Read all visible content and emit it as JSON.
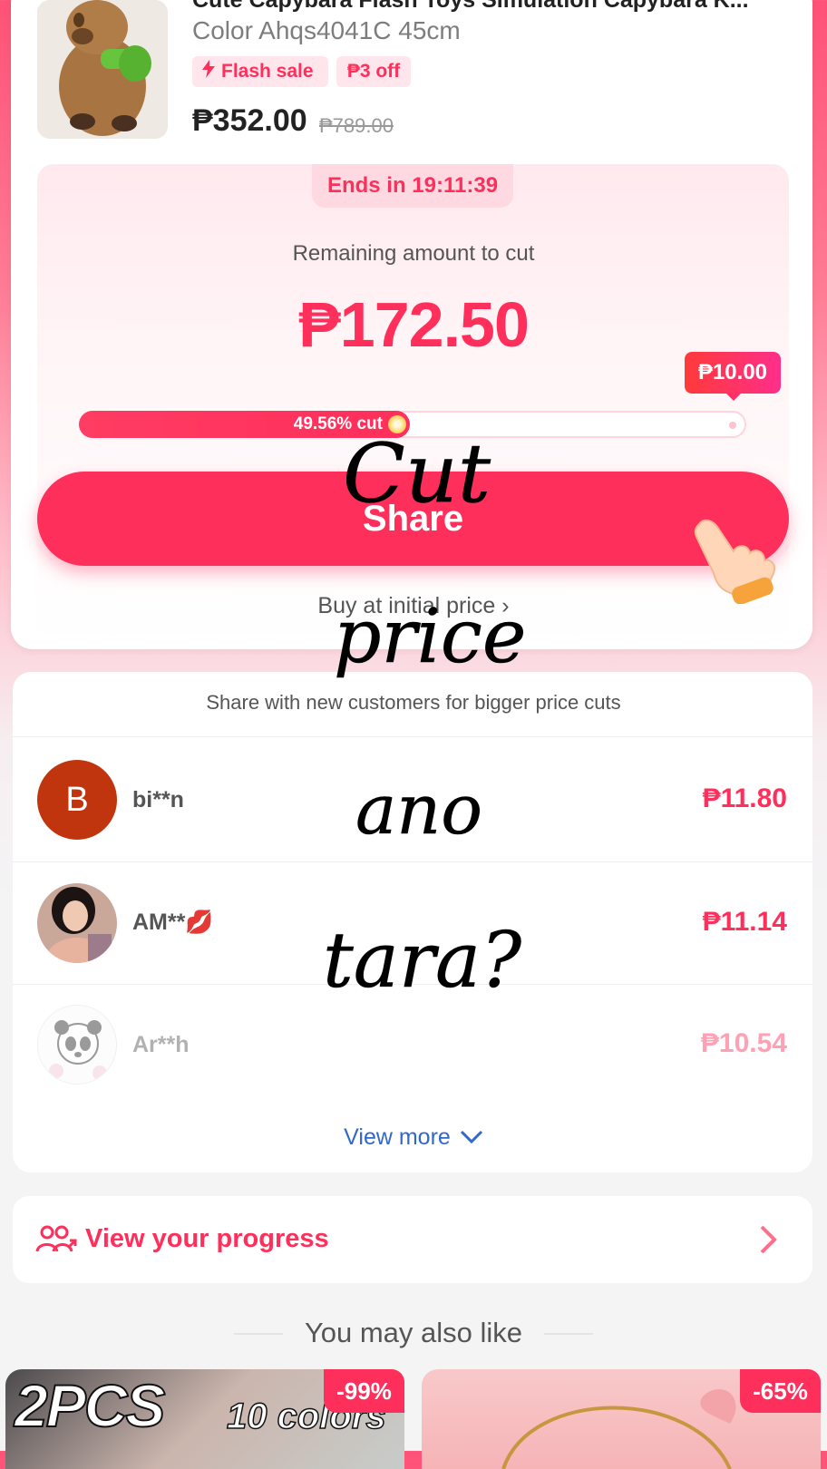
{
  "product": {
    "title": "Cute Capybara Flash Toys Simulation Capybara K...",
    "variant": "Color Ahqs4041C 45cm",
    "badges": {
      "flash": "Flash sale",
      "off": "₱3 off"
    },
    "price": "₱352.00",
    "original_price": "₱789.00"
  },
  "cut": {
    "ends_in": "Ends in 19:11:39",
    "remaining_label": "Remaining amount to cut",
    "remaining_amount": "₱172.50",
    "target_tag": "₱10.00",
    "progress_label": "49.56% cut",
    "progress_fraction": 0.4956,
    "share_label": "Share",
    "buy_initial": "Buy at initial price ›"
  },
  "helpers": {
    "note": "Share with new customers for bigger price cuts",
    "rows": [
      {
        "avatar_letter": "B",
        "name": "bi**n",
        "amount": "₱11.80"
      },
      {
        "name": "AM**💋",
        "amount": "₱11.14"
      },
      {
        "name": "Ar**h",
        "amount": "₱10.54"
      }
    ],
    "view_more": "View more"
  },
  "progress_link": "View your progress",
  "also_like": {
    "heading": "You may also like",
    "items": [
      {
        "discount": "-99%",
        "banner_main": "2PCS",
        "banner_sub": "10 colors"
      },
      {
        "discount": "-65%"
      }
    ]
  },
  "overlay": [
    "Cut",
    "price",
    "ano",
    "tara?"
  ],
  "colors": {
    "accent": "#ff2f5b",
    "link": "#3367c9"
  }
}
